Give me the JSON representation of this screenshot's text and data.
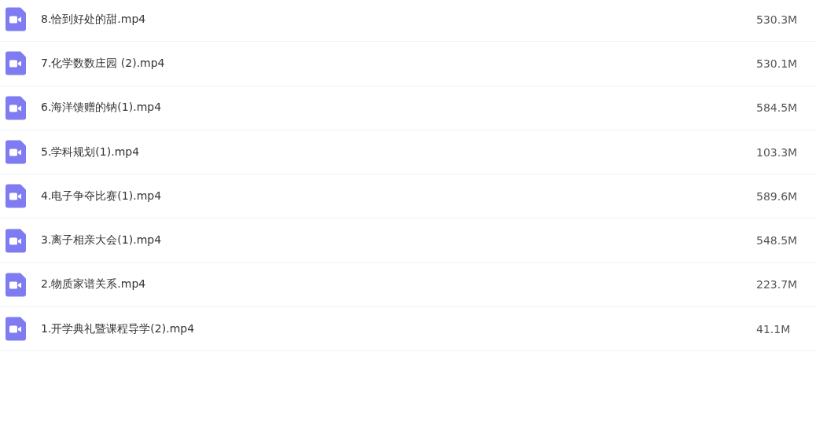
{
  "files": [
    {
      "name": "8.恰到好处的甜.mp4",
      "size": "530.3M"
    },
    {
      "name": "7.化学数数庄园 (2).mp4",
      "size": "530.1M"
    },
    {
      "name": "6.海洋馈赠的钠(1).mp4",
      "size": "584.5M"
    },
    {
      "name": "5.学科规划(1).mp4",
      "size": "103.3M"
    },
    {
      "name": "4.电子争夺比赛(1).mp4",
      "size": "589.6M"
    },
    {
      "name": "3.离子相亲大会(1).mp4",
      "size": "548.5M"
    },
    {
      "name": "2.物质家谱关系.mp4",
      "size": "223.7M"
    },
    {
      "name": "1.开学典礼暨课程导学(2).mp4",
      "size": "41.1M"
    }
  ]
}
